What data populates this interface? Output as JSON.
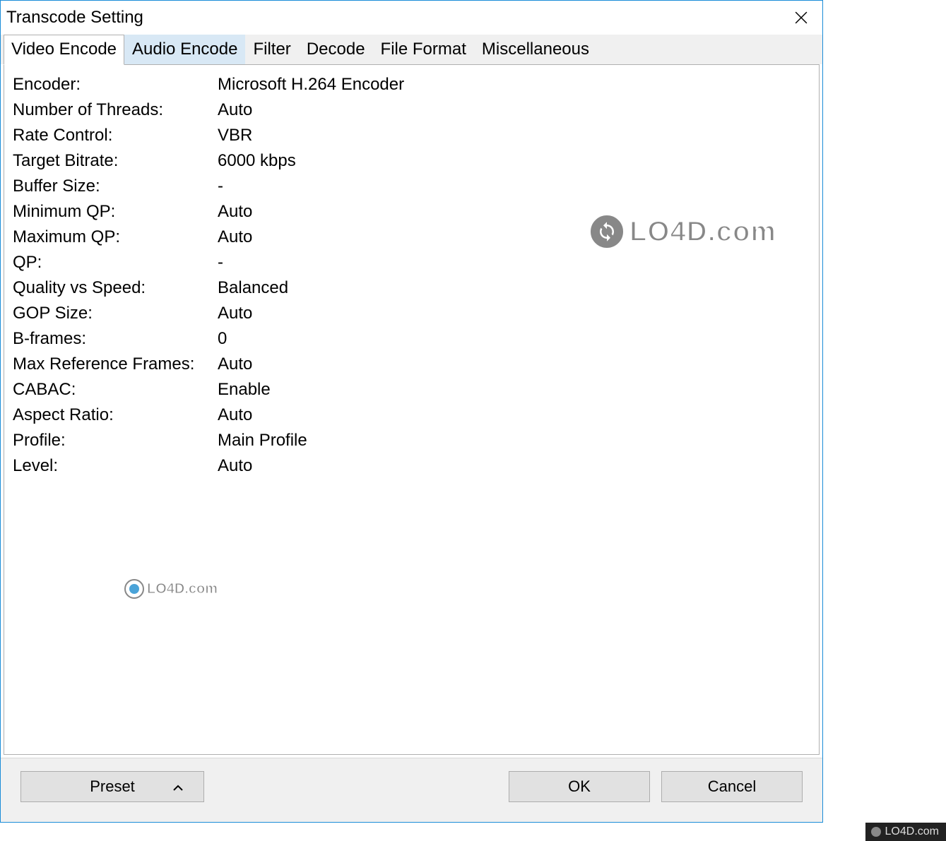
{
  "window": {
    "title": "Transcode Setting"
  },
  "tabs": [
    {
      "label": "Video Encode"
    },
    {
      "label": "Audio Encode"
    },
    {
      "label": "Filter"
    },
    {
      "label": "Decode"
    },
    {
      "label": "File Format"
    },
    {
      "label": "Miscellaneous"
    }
  ],
  "active_tab": 0,
  "settings": [
    {
      "label": "Encoder:",
      "value": "Microsoft H.264 Encoder"
    },
    {
      "label": "Number of Threads:",
      "value": "Auto"
    },
    {
      "label": "Rate Control:",
      "value": "VBR"
    },
    {
      "label": "Target Bitrate:",
      "value": "6000 kbps"
    },
    {
      "label": "Buffer Size:",
      "value": "-"
    },
    {
      "label": "Minimum QP:",
      "value": "Auto"
    },
    {
      "label": "Maximum QP:",
      "value": "Auto"
    },
    {
      "label": "QP:",
      "value": "-"
    },
    {
      "label": "Quality vs Speed:",
      "value": "Balanced"
    },
    {
      "label": "GOP Size:",
      "value": "Auto"
    },
    {
      "label": "B-frames:",
      "value": "0"
    },
    {
      "label": "Max Reference Frames:",
      "value": "Auto"
    },
    {
      "label": "CABAC:",
      "value": "Enable"
    },
    {
      "label": "Aspect Ratio:",
      "value": "Auto"
    },
    {
      "label": "Profile:",
      "value": "Main Profile"
    },
    {
      "label": "Level:",
      "value": "Auto"
    }
  ],
  "buttons": {
    "preset": "Preset",
    "ok": "OK",
    "cancel": "Cancel"
  },
  "watermark": "LO4D.com"
}
